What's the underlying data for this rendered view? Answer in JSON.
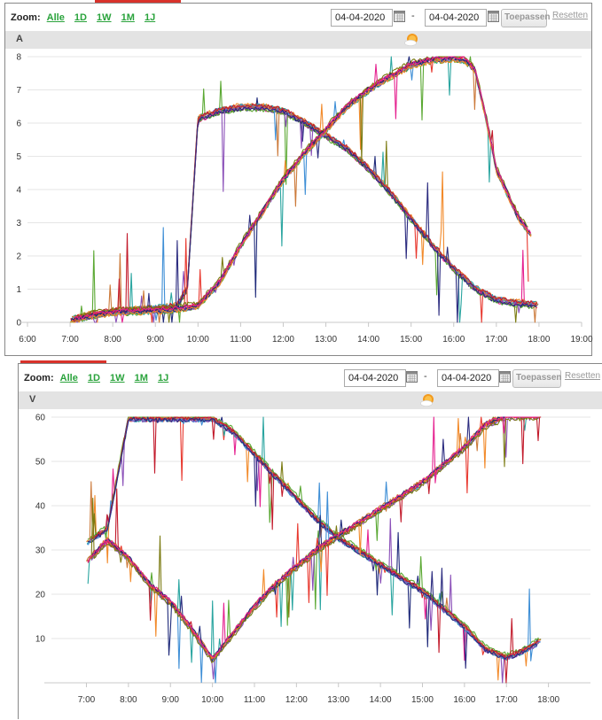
{
  "toolbar": {
    "zoom_label": "Zoom:",
    "zoom_options": [
      "Alle",
      "1D",
      "1W",
      "1M",
      "1J"
    ],
    "date_from": "04-04-2020",
    "date_separator": "-",
    "date_to": "04-04-2020",
    "apply_label": "Toepassen",
    "reset_label": "Resetten"
  },
  "colors": {
    "zoom_link": "#2aa33c",
    "accent_bar": "#d9322b",
    "title_bar": "#e3e3e3",
    "series": [
      "#e8382e",
      "#f28a2a",
      "#7b7b12",
      "#1f2a7a",
      "#e5208f",
      "#2aa5a0",
      "#5aa832",
      "#3f8fd6",
      "#8a4fb8",
      "#cc7a3a",
      "#c21a2b",
      "#2b2b7f"
    ]
  },
  "icons": {
    "date_picker": "calendar-icon",
    "weather": "sun-cloud-icon"
  },
  "chart_data": [
    {
      "type": "line",
      "ylabel": "A",
      "xlim": [
        "06:00",
        "19:00"
      ],
      "ylim": [
        0,
        8
      ],
      "x_ticks": [
        "6:00",
        "7:00",
        "8:00",
        "9:00",
        "10:00",
        "11:00",
        "12:00",
        "13:00",
        "14:00",
        "15:00",
        "16:00",
        "17:00",
        "18:00",
        "19:00"
      ],
      "y_ticks": [
        "0",
        "1",
        "2",
        "3",
        "4",
        "5",
        "6",
        "7",
        "8"
      ],
      "grid": true,
      "series": [
        {
          "group": "early-peak",
          "x": [
            "07:00",
            "07:30",
            "08:00",
            "08:30",
            "09:00",
            "09:30",
            "09:45",
            "10:00",
            "10:30",
            "11:00",
            "11:30",
            "12:00",
            "12:30",
            "13:00",
            "13:30",
            "14:00",
            "14:30",
            "15:00",
            "15:30",
            "16:00",
            "16:30",
            "17:00",
            "17:30",
            "18:00"
          ],
          "y": [
            0.05,
            0.2,
            0.3,
            0.35,
            0.4,
            0.45,
            1.0,
            6.1,
            6.35,
            6.45,
            6.45,
            6.35,
            6.0,
            5.6,
            5.2,
            4.6,
            3.9,
            3.1,
            2.3,
            1.6,
            1.0,
            0.65,
            0.55,
            0.5
          ]
        },
        {
          "group": "late-peak",
          "x": [
            "07:00",
            "07:30",
            "08:00",
            "08:30",
            "09:00",
            "09:30",
            "10:00",
            "10:30",
            "11:00",
            "11:30",
            "12:00",
            "12:30",
            "13:00",
            "13:30",
            "14:00",
            "14:30",
            "15:00",
            "15:30",
            "16:00",
            "16:15",
            "16:30",
            "16:45",
            "17:00",
            "17:30",
            "17:50"
          ],
          "y": [
            0.05,
            0.2,
            0.3,
            0.33,
            0.36,
            0.4,
            0.5,
            1.2,
            2.3,
            3.3,
            4.3,
            5.1,
            5.8,
            6.5,
            7.0,
            7.4,
            7.75,
            7.9,
            7.95,
            7.9,
            7.6,
            6.2,
            4.6,
            3.2,
            2.6
          ]
        }
      ]
    },
    {
      "type": "line",
      "ylabel": "V",
      "xlim": [
        "06:10",
        "19:00"
      ],
      "ylim": [
        0,
        60
      ],
      "x_ticks": [
        "7:00",
        "8:00",
        "9:00",
        "10:00",
        "11:00",
        "12:00",
        "13:00",
        "14:00",
        "15:00",
        "16:00",
        "17:00",
        "18:00"
      ],
      "y_ticks": [
        "10",
        "20",
        "30",
        "40",
        "50",
        "60"
      ],
      "grid": true,
      "series": [
        {
          "group": "falling-voltage",
          "x": [
            "07:00",
            "07:30",
            "08:00",
            "08:30",
            "09:00",
            "09:30",
            "10:00",
            "10:30",
            "11:00",
            "11:30",
            "12:00",
            "12:30",
            "13:00",
            "13:30",
            "14:00",
            "14:30",
            "15:00",
            "15:30",
            "16:00",
            "16:30",
            "17:00",
            "17:30",
            "17:50"
          ],
          "y": [
            32,
            35,
            60,
            60,
            60,
            60,
            60,
            57,
            52,
            47,
            42,
            37,
            33,
            30,
            27,
            24,
            21,
            17,
            13,
            8,
            6,
            8,
            10
          ]
        },
        {
          "group": "rising-voltage",
          "x": [
            "07:00",
            "07:30",
            "08:00",
            "08:30",
            "09:00",
            "09:30",
            "10:00",
            "10:30",
            "11:00",
            "11:30",
            "12:00",
            "12:30",
            "13:00",
            "13:30",
            "14:00",
            "14:30",
            "15:00",
            "15:30",
            "16:00",
            "16:30",
            "17:00",
            "17:30",
            "17:50"
          ],
          "y": [
            27,
            32,
            28,
            22,
            18,
            12,
            5,
            11,
            17,
            22,
            26,
            30,
            33,
            36,
            39,
            42,
            45,
            49,
            53,
            58,
            60,
            60,
            60
          ]
        }
      ]
    }
  ]
}
